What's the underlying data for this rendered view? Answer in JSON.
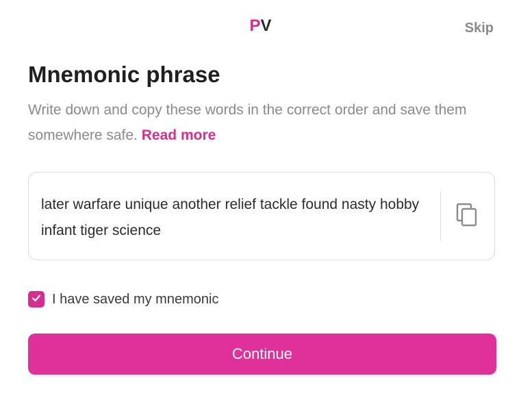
{
  "header": {
    "logo_p": "P",
    "logo_v": "V",
    "skip_label": "Skip"
  },
  "page": {
    "title": "Mnemonic phrase",
    "description": "Write down and copy these words in the correct order and save them somewhere safe.",
    "read_more_label": "Read more"
  },
  "mnemonic": {
    "phrase": "later warfare unique another relief tackle found nasty hobby infant tiger science",
    "copy_icon": "copy-icon"
  },
  "confirmation": {
    "checked": true,
    "label": "I have saved my mnemonic"
  },
  "actions": {
    "continue_label": "Continue"
  },
  "colors": {
    "accent": "#e0309a",
    "logo_p": "#d62e8f",
    "muted_text": "#8a8a8a",
    "border": "#dcdcdc"
  }
}
